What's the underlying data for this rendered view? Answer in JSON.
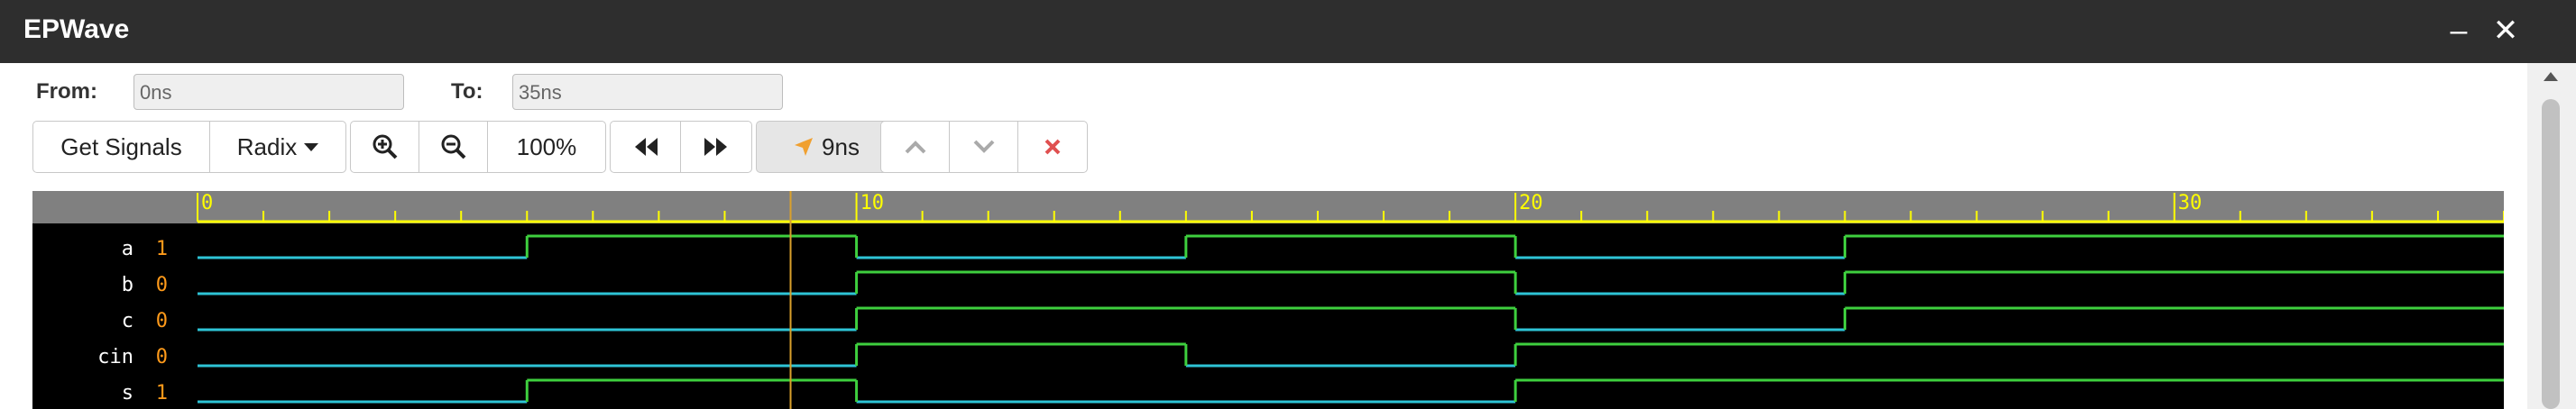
{
  "window": {
    "title": "EPWave",
    "minimize_glyph": "–",
    "close_glyph": "✕"
  },
  "range": {
    "from_label": "From:",
    "from_value": "0ns",
    "to_label": "To:",
    "to_value": "35ns"
  },
  "toolbar": {
    "get_signals": "Get Signals",
    "radix": "Radix",
    "zoom": "100%",
    "cursor_time": "9ns"
  },
  "colors": {
    "ruler_bg": "#808080",
    "tick": "#ffff00",
    "wave_bg": "#000000",
    "low_wave": "#2ec4d6",
    "high_wave": "#3ecf3e",
    "cursor": "#d9a02c",
    "signal_value": "#ff9a1a"
  },
  "waves": {
    "ticks_major": [
      "0",
      "10",
      "20",
      "30"
    ],
    "time_start_ns": 0,
    "time_end_ns": 35,
    "cursor_ns": 9,
    "signals": [
      {
        "name": "a",
        "value": "1",
        "transitions": [
          [
            0,
            0
          ],
          [
            5,
            1
          ],
          [
            10,
            0
          ],
          [
            15,
            1
          ],
          [
            20,
            0
          ],
          [
            25,
            1
          ]
        ]
      },
      {
        "name": "b",
        "value": "0",
        "transitions": [
          [
            0,
            0
          ],
          [
            10,
            1
          ],
          [
            20,
            0
          ],
          [
            25,
            1
          ]
        ]
      },
      {
        "name": "c",
        "value": "0",
        "transitions": [
          [
            0,
            0
          ],
          [
            10,
            1
          ],
          [
            20,
            0
          ],
          [
            25,
            1
          ]
        ]
      },
      {
        "name": "cin",
        "value": "0",
        "transitions": [
          [
            0,
            0
          ],
          [
            10,
            1
          ],
          [
            15,
            0
          ],
          [
            20,
            1
          ]
        ]
      },
      {
        "name": "s",
        "value": "1",
        "transitions": [
          [
            0,
            0
          ],
          [
            5,
            1
          ],
          [
            10,
            0
          ],
          [
            20,
            1
          ]
        ]
      }
    ]
  }
}
